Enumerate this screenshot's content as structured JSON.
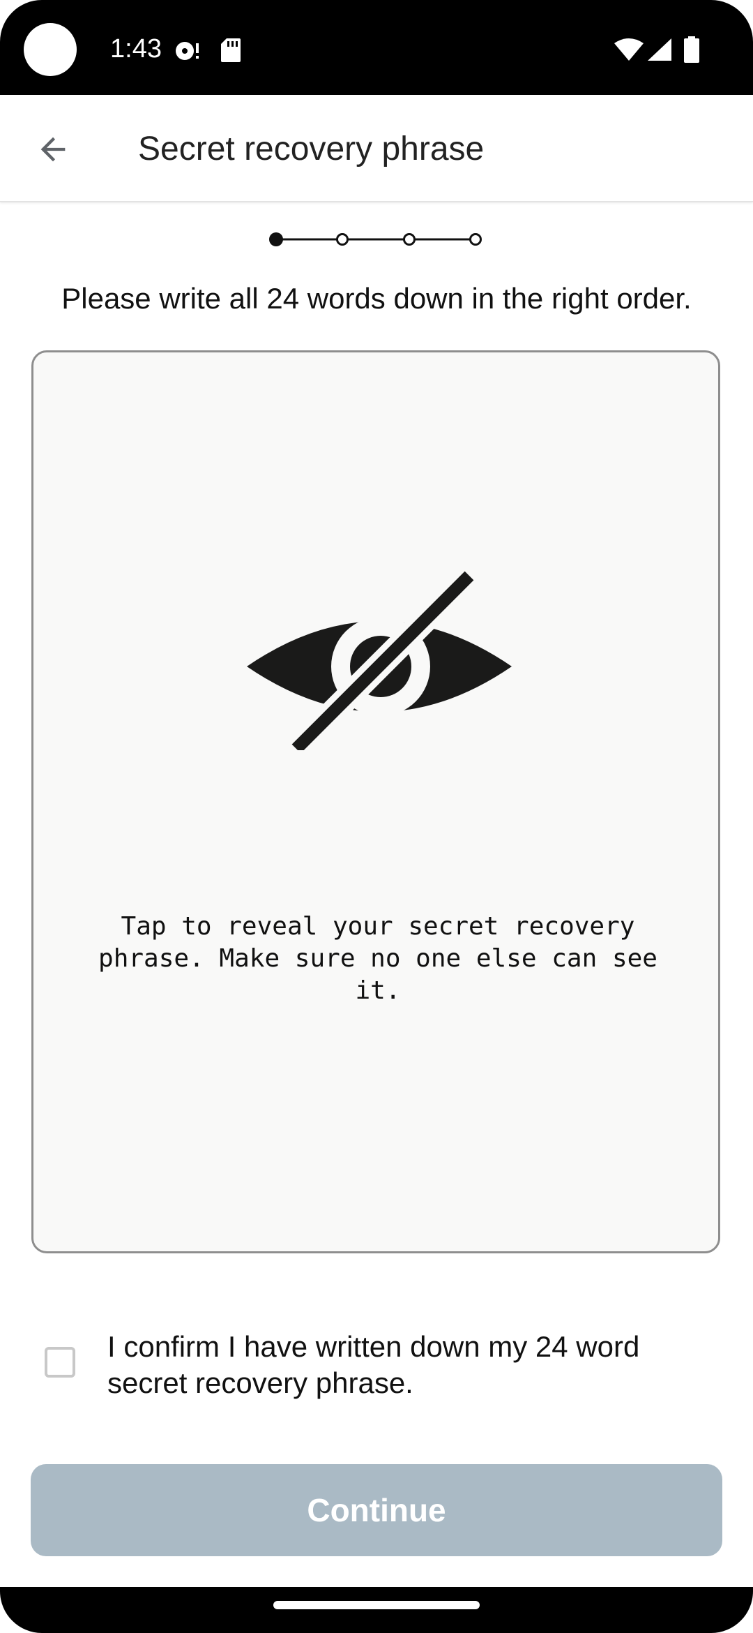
{
  "status_bar": {
    "time": "1:43",
    "icons": [
      "camera-hole",
      "media-icon",
      "sd-card-icon",
      "wifi-icon",
      "signal-icon",
      "battery-icon"
    ]
  },
  "app_bar": {
    "back_icon": "arrow-left-icon",
    "title": "Secret recovery phrase"
  },
  "stepper": {
    "total_steps": 4,
    "current_step": 1
  },
  "instruction": "Please write all 24 words down in the right order.",
  "reveal_card": {
    "icon": "eye-off-icon",
    "text": "Tap to reveal your secret recovery phrase. Make sure no one else can see it."
  },
  "confirm": {
    "checked": false,
    "label": "I confirm I have written down my 24 word secret recovery phrase."
  },
  "continue_button": {
    "label": "Continue",
    "enabled": false,
    "color": "#aabac5"
  },
  "colors": {
    "card_background": "#f9f9f8",
    "card_border": "#8e8e8e",
    "text": "#111111"
  }
}
